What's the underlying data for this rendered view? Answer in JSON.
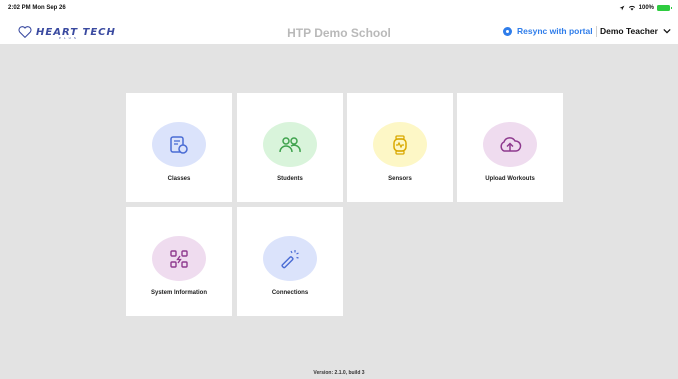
{
  "status_bar": {
    "time_date": "2:02 PM  Mon Sep 26",
    "battery_text": "100%"
  },
  "header": {
    "logo_text": "HEART TECH",
    "logo_subtext": "PLUS",
    "school_name": "HTP Demo School",
    "resync_label": "Resync with portal",
    "user_name": "Demo Teacher"
  },
  "tiles": [
    {
      "label": "Classes",
      "icon": "classes-icon",
      "color": "#dbe3fb"
    },
    {
      "label": "Students",
      "icon": "students-icon",
      "color": "#d9f4db"
    },
    {
      "label": "Sensors",
      "icon": "sensor-icon",
      "color": "#fdf7c6"
    },
    {
      "label": "Upload Workouts",
      "icon": "cloud-upload-icon",
      "color": "#efdcef"
    },
    {
      "label": "System Information",
      "icon": "system-info-icon",
      "color": "#efdcef"
    },
    {
      "label": "Connections",
      "icon": "magic-wand-icon",
      "color": "#dbe3fb"
    }
  ],
  "footer": {
    "version": "Version: 2.1.0, build 3"
  },
  "colors": {
    "accent": "#2f7dea",
    "background": "#e3e3e3",
    "icon_blue": "#4a6cd4",
    "icon_green": "#3fa34d",
    "icon_yellow": "#d9a800",
    "icon_purple": "#8e3a8e"
  }
}
